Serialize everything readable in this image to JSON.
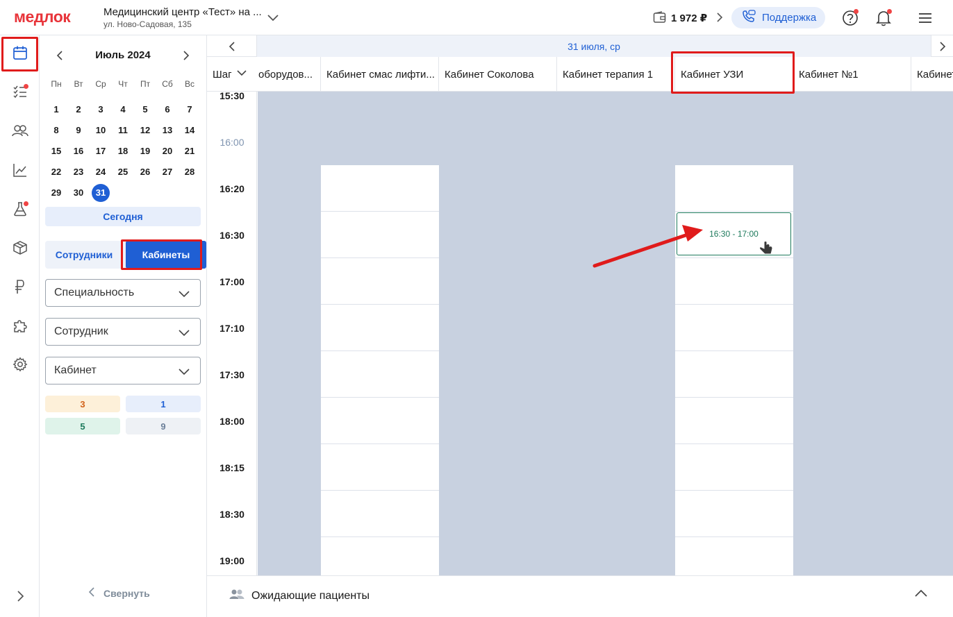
{
  "header": {
    "logo": "медлок",
    "clinic_name": "Медицинский центр «Тест» на ...",
    "clinic_address": "ул. Ново-Садовая, 135",
    "balance": "1 972 ₽",
    "support_label": "Поддержка"
  },
  "calendar": {
    "month": "Июль 2024",
    "weekdays": [
      "Пн",
      "Вт",
      "Ср",
      "Чт",
      "Пт",
      "Сб",
      "Вс"
    ],
    "days": [
      "1",
      "2",
      "3",
      "4",
      "5",
      "6",
      "7",
      "8",
      "9",
      "10",
      "11",
      "12",
      "13",
      "14",
      "15",
      "16",
      "17",
      "18",
      "19",
      "20",
      "21",
      "22",
      "23",
      "24",
      "25",
      "26",
      "27",
      "28",
      "29",
      "30",
      "31"
    ],
    "selected_day": "31",
    "today_label": "Сегодня"
  },
  "mode": {
    "employees_label": "Сотрудники",
    "cabinets_label": "Кабинеты"
  },
  "filters": {
    "specialty": "Специальность",
    "employee": "Сотрудник",
    "cabinet": "Кабинет"
  },
  "counters": [
    {
      "value": "3",
      "bg": "#fdf0d9",
      "fg": "#d2621a"
    },
    {
      "value": "1",
      "bg": "#e7eefb",
      "fg": "#1f5fd4"
    },
    {
      "value": "5",
      "bg": "#dff3ea",
      "fg": "#1d7a5c"
    },
    {
      "value": "9",
      "bg": "#eef1f5",
      "fg": "#6b7f99"
    }
  ],
  "collapse_label": "Свернуть",
  "schedule": {
    "date": "31 июля, ср",
    "step_label": "Шаг",
    "columns": [
      "оборудов...",
      "Кабинет смас лифти...",
      "Кабинет Соколова",
      "Кабинет терапия 1",
      "Кабинет УЗИ",
      "Кабинет №1",
      "Кабинет"
    ],
    "times": [
      "15:30",
      "16:00",
      "16:20",
      "16:30",
      "17:00",
      "17:10",
      "17:30",
      "18:00",
      "18:15",
      "18:30",
      "19:00"
    ],
    "slot": "16:30 - 17:00"
  },
  "waiting_label": "Ожидающие пациенты",
  "colors": {
    "accent": "#1f5fd4",
    "logo": "#e8343a",
    "unavailable": "#c8d1e0",
    "slot": "#1d7a5c",
    "highlight": "#e01b1b"
  }
}
